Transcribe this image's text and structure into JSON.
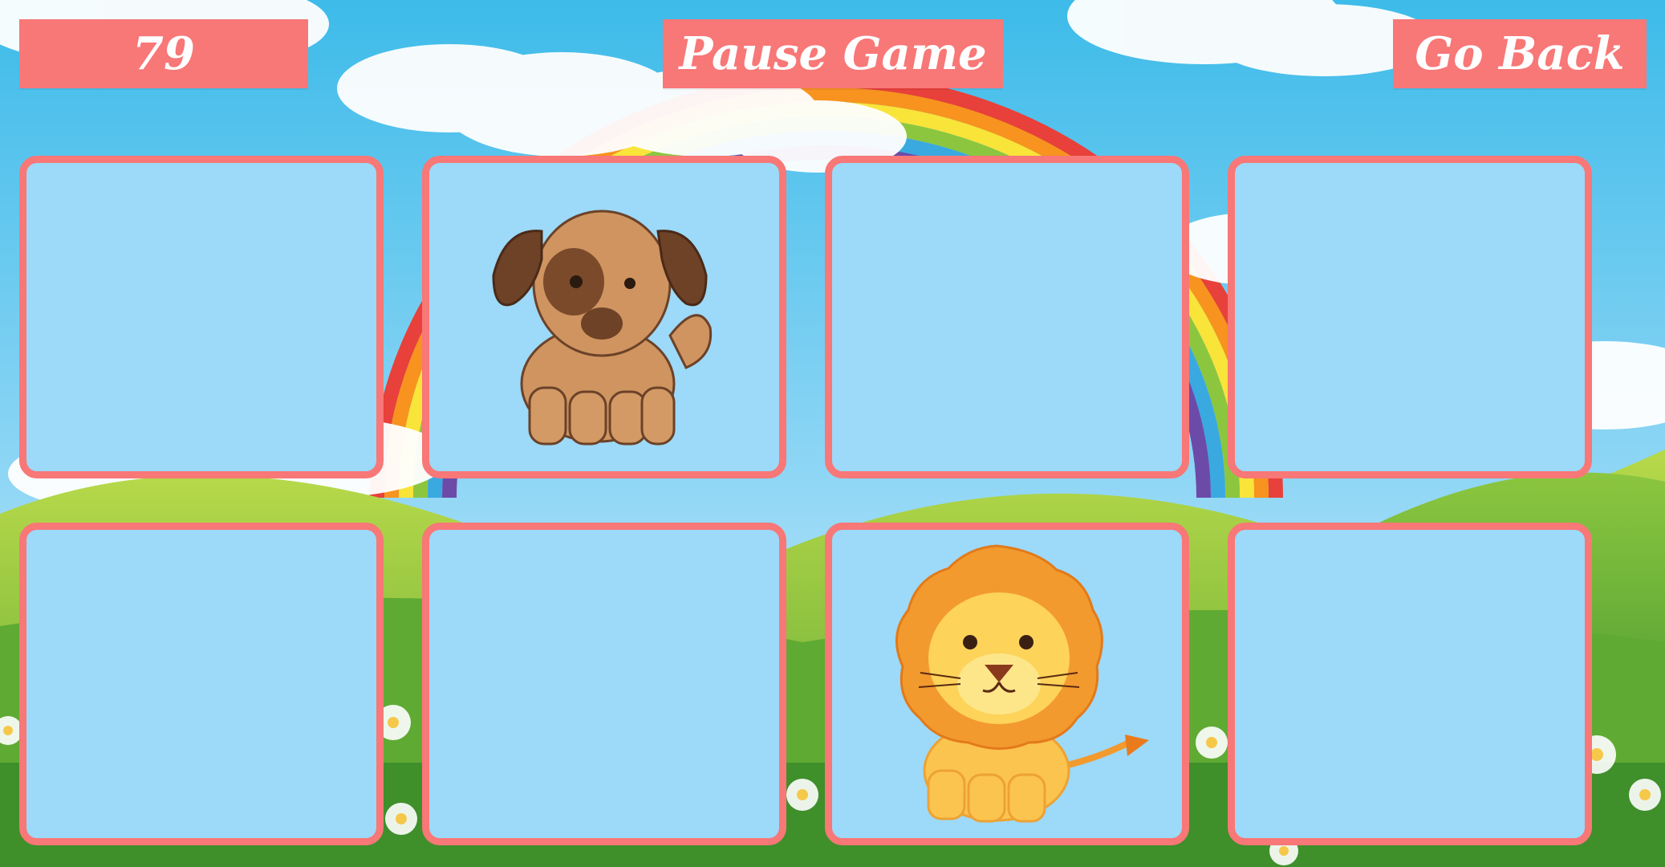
{
  "hud": {
    "score": "79",
    "pause_label": "Pause Game",
    "back_label": "Go Back"
  },
  "colors": {
    "accent": "#f87777",
    "card_face": "#9dd9f8",
    "sky_top": "#3dbbe9",
    "sky_bottom": "#bfe9fb"
  },
  "cards": [
    {
      "state": "hidden",
      "image": null
    },
    {
      "state": "revealed",
      "image": "dog-icon"
    },
    {
      "state": "hidden",
      "image": null
    },
    {
      "state": "hidden",
      "image": null
    },
    {
      "state": "hidden",
      "image": null
    },
    {
      "state": "hidden",
      "image": null
    },
    {
      "state": "revealed",
      "image": "lion-icon"
    },
    {
      "state": "hidden",
      "image": null
    }
  ]
}
